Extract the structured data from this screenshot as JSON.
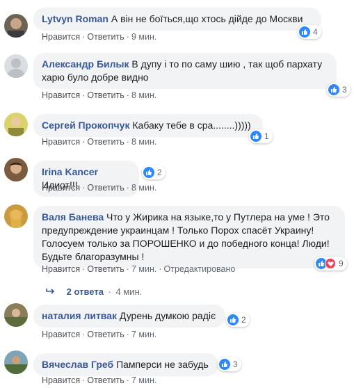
{
  "comments": [
    {
      "author": "Lytvyn Roman",
      "text": "А він не боїться,що хтось дійде до Москви",
      "like": "Нравится",
      "reply": "Ответить",
      "time": "9 мин.",
      "reaction_count": "4",
      "reactions": [
        "like"
      ]
    },
    {
      "author": "Александр Билык",
      "text": "В дупу і то по саму шию , так щоб пархату харю було добре видно",
      "like": "Нравится",
      "reply": "Ответить",
      "time": "8 мин.",
      "reaction_count": "3",
      "reactions": [
        "like"
      ]
    },
    {
      "author": "Сергей Прокопчук",
      "text": "Кабаку тебе в сра........)))))",
      "like": "Нравится",
      "reply": "Ответить",
      "time": "8 мин.",
      "reaction_count": "1",
      "reactions": [
        "like"
      ]
    },
    {
      "author": "Irina Kancer",
      "text": "Идиот!!!",
      "like": "Нравится",
      "reply": "Ответить",
      "time": "8 мин.",
      "reaction_count": "2",
      "reactions": [
        "like"
      ]
    },
    {
      "author": "Валя Банева",
      "text": "Что у Жирика на языке,то у Путлера на уме ! Это предупреждение украинцам ! Только Порох спасёт Украину! Голосуем только за ПОРОШЕНКО и до победного конца! Люди! Будьте благоразумны !",
      "like": "Нравится",
      "reply": "Ответить",
      "time": "7 мин.",
      "edited": "Отредактировано",
      "reaction_count": "9",
      "reactions": [
        "like",
        "love"
      ]
    },
    {
      "author": "наталия литвак",
      "text": "Дурень думкою радіє",
      "like": "Нравится",
      "reply": "Ответить",
      "time": "7 мин.",
      "reaction_count": "2",
      "reactions": [
        "like"
      ]
    },
    {
      "author": "Вячеслав Греб",
      "text": "Памперси не забудь",
      "like": "Нравится",
      "reply": "Ответить",
      "time": "7 мин.",
      "reaction_count": "3",
      "reactions": [
        "like"
      ]
    }
  ],
  "replies_link": {
    "text": "2 ответа",
    "time": "4 мин."
  },
  "separator": "·",
  "colors": {
    "link": "#385898",
    "bubble": "#f2f3f5",
    "like": "#2d88ff",
    "love": "#f33e58"
  },
  "icons": {
    "like": "thumbs-up-icon",
    "love": "heart-icon",
    "reply_arrow": "reply-arrow-icon"
  }
}
